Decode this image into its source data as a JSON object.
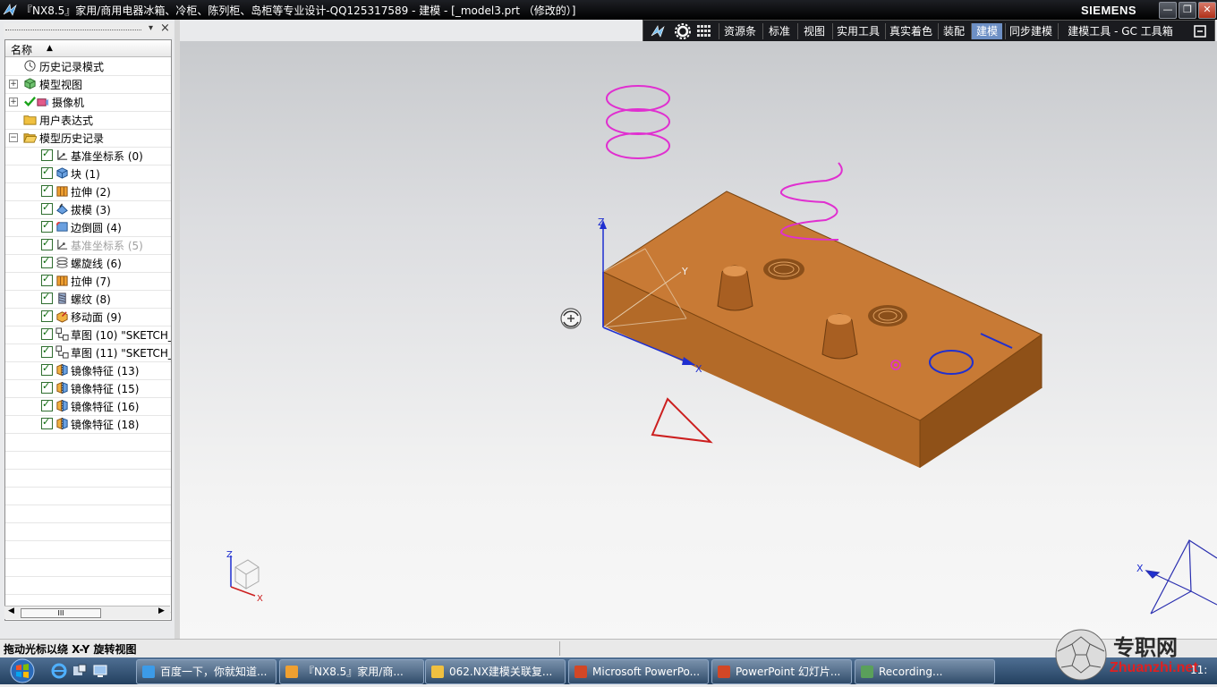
{
  "window": {
    "title": "『NX8.5』家用/商用电器冰箱、冷柜、陈列柜、岛柜等专业设计-QQ125317589 - 建模 - [_model3.prt （修改的）]",
    "brand": "SIEMENS",
    "buttons": {
      "minimize": "—",
      "restore": "❐",
      "close": "✕"
    }
  },
  "toolbar": {
    "items": [
      "资源条",
      "标准",
      "视图",
      "实用工具",
      "真实着色",
      "装配",
      "建模",
      "同步建模",
      "建模工具 - GC 工具箱"
    ],
    "active": "建模"
  },
  "navigator": {
    "column_header": "名称",
    "sort_glyph": "▲",
    "close_glyph": "×",
    "pin_glyph": "▾",
    "top_nodes": [
      {
        "label": "历史记录模式"
      },
      {
        "label": "模型视图",
        "expander": "+"
      },
      {
        "label": "摄像机",
        "expander": "+"
      },
      {
        "label": "用户表达式"
      },
      {
        "label": "模型历史记录",
        "expander": "−"
      }
    ],
    "features": [
      {
        "label": "基准坐标系 (0)"
      },
      {
        "label": "块 (1)"
      },
      {
        "label": "拉伸 (2)"
      },
      {
        "label": "拔模 (3)"
      },
      {
        "label": "边倒圆 (4)"
      },
      {
        "label": "基准坐标系 (5)",
        "disabled": true
      },
      {
        "label": "螺旋线 (6)"
      },
      {
        "label": "拉伸 (7)"
      },
      {
        "label": "螺纹 (8)"
      },
      {
        "label": "移动面 (9)"
      },
      {
        "label": "草图 (10) \"SKETCH_"
      },
      {
        "label": "草图 (11) \"SKETCH_"
      },
      {
        "label": "镜像特征 (13)"
      },
      {
        "label": "镜像特征 (15)"
      },
      {
        "label": "镜像特征 (16)"
      },
      {
        "label": "镜像特征 (18)"
      }
    ],
    "scroll_thumb": "III"
  },
  "viewport": {
    "axis_labels": {
      "z": "Z",
      "y": "Y",
      "x": "X"
    },
    "triad_labels": {
      "z": "Z",
      "x": "X"
    },
    "corner_label": "X"
  },
  "status": {
    "prompt": "拖动光标以绕 X-Y 旋转视图"
  },
  "taskbar": {
    "tasks": [
      "百度一下，你就知道...",
      "『NX8.5』家用/商...",
      "062.NX建模关联复...",
      "Microsoft PowerPo...",
      "PowerPoint 幻灯片...",
      "Recording..."
    ],
    "clock": "11:"
  },
  "watermark": {
    "text": "专职网",
    "url": "Zhuanzhi.net"
  },
  "colors": {
    "accent": "#6d8fc4",
    "part": "#c87a35",
    "helix": "#e02fd0",
    "sketch_red": "#cc1f1f",
    "sketch_blue": "#1f2fd0"
  }
}
